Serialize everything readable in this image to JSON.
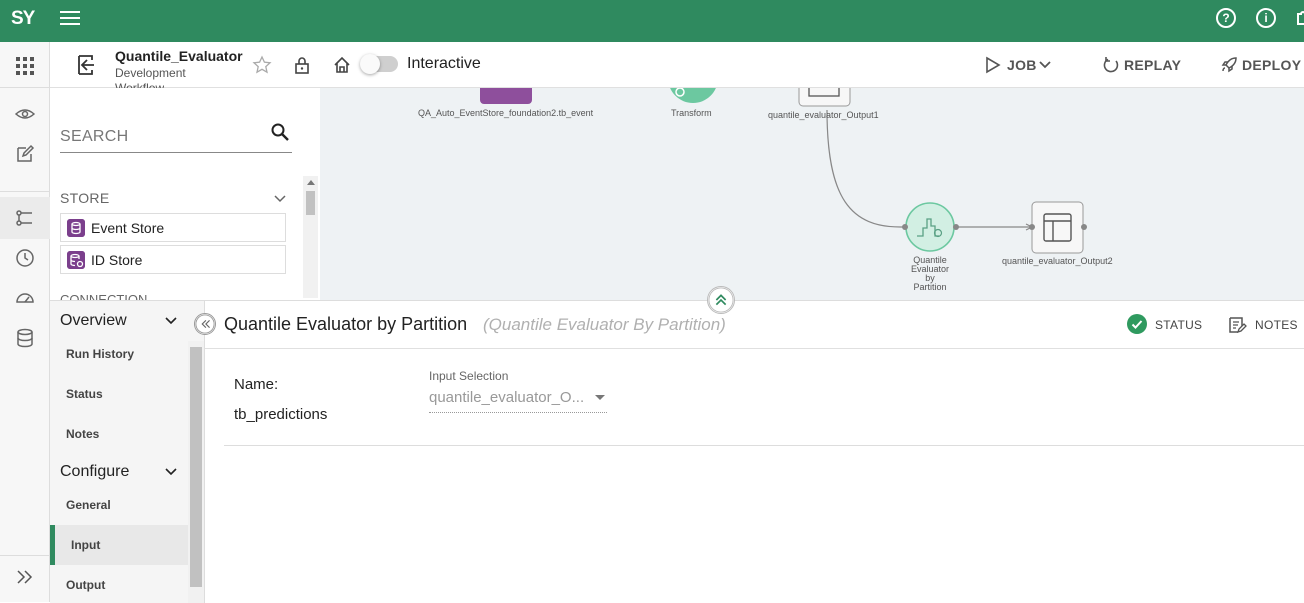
{
  "app": {
    "logo": "SY",
    "menu_icon": "hamburger-menu-icon",
    "top_icons": [
      "help-icon",
      "info-icon",
      "puzzle-icon"
    ],
    "brand_color": "#2f8a5f"
  },
  "rail": {
    "icons": [
      "apps-grid-icon",
      "eye-icon",
      "edit-icon",
      "workflow-icon",
      "history-icon",
      "dashboard-icon",
      "database-icon",
      "expand-icon"
    ]
  },
  "header": {
    "workflow_name": "Quantile_Evaluator",
    "workflow_sub1": "Development",
    "workflow_sub2": "Workflow",
    "interactive_label": "Interactive",
    "job_label": "JOB",
    "replay_label": "REPLAY",
    "deploy_label": "DEPLOY"
  },
  "palette": {
    "search_placeholder": "SEARCH",
    "store_header": "STORE",
    "items": [
      {
        "label": "Event Store",
        "icon": "event-store-icon"
      },
      {
        "label": "ID Store",
        "icon": "id-store-icon"
      }
    ],
    "connection_header": "CONNECTION"
  },
  "canvas": {
    "nodes": [
      {
        "label": "QA_Auto_EventStore_foundation2.tb_event",
        "type": "store"
      },
      {
        "label": "Transform",
        "type": "transform"
      },
      {
        "label": "quantile_evaluator_Output1",
        "type": "output"
      },
      {
        "label": "Quantile Evaluator by Partition",
        "type": "evaluator"
      },
      {
        "label": "quantile_evaluator_Output2",
        "type": "output"
      }
    ],
    "evaluator_lines": [
      "Quantile",
      "Evaluator",
      "by",
      "Partition"
    ]
  },
  "props": {
    "overview_label": "Overview",
    "overview_items": [
      "Run History",
      "Status",
      "Notes"
    ],
    "configure_label": "Configure",
    "configure_items": [
      "General",
      "Input",
      "Output"
    ],
    "active_item": "Input",
    "title": "Quantile Evaluator by Partition",
    "subtitle": "(Quantile Evaluator By Partition)",
    "status_label": "STATUS",
    "notes_label": "NOTES",
    "name_label": "Name:",
    "name_value": "tb_predictions",
    "input_selection_label": "Input Selection",
    "input_selection_value": "quantile_evaluator_O..."
  }
}
